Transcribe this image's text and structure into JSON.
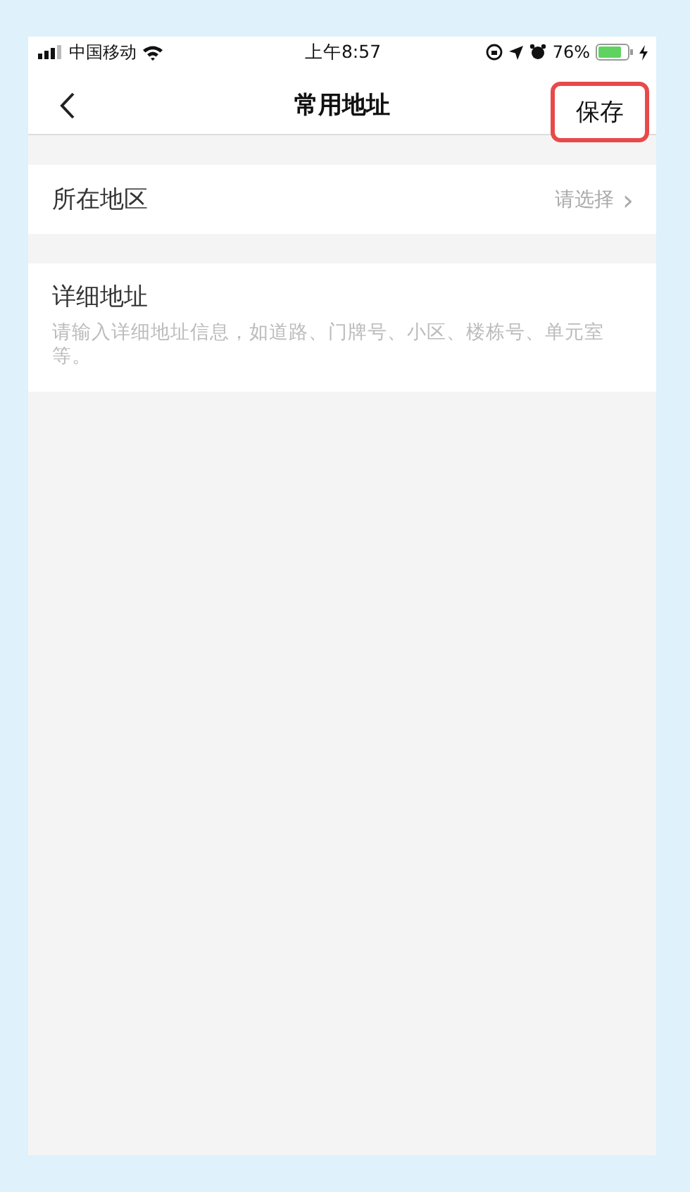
{
  "status_bar": {
    "carrier": "中国移动",
    "time": "上午8:57",
    "battery": "76%"
  },
  "nav": {
    "title": "常用地址",
    "save": {
      "label": "保存",
      "highlighted": true
    }
  },
  "region": {
    "label": "所在地区",
    "value": "请选择",
    "chevron": "›"
  },
  "detail": {
    "label": "详细地址",
    "placeholder": "请输入详细地址信息，如道路、门牌号、小区、楼栋号、单元室等。"
  }
}
